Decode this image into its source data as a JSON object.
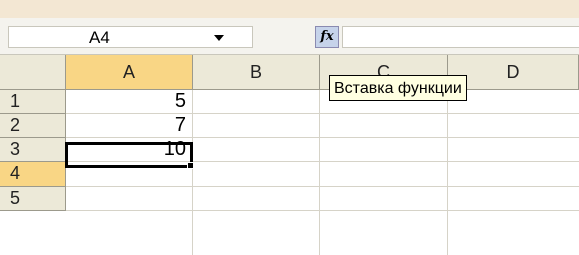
{
  "formula_bar": {
    "name_box_value": "A4",
    "fx_label": "fx",
    "formula_value": ""
  },
  "columns": [
    "A",
    "B",
    "C",
    "D"
  ],
  "rows": [
    "1",
    "2",
    "3",
    "4",
    "5"
  ],
  "cells": {
    "A1": "5",
    "A2": "7",
    "A3": "10",
    "A4": ""
  },
  "active_cell": "A4",
  "tooltip": {
    "text": "Вставка функции"
  },
  "colors": {
    "header_bg": "#ece9d8",
    "active_header_bg": "#f9d685",
    "tooltip_bg": "#ffffe1",
    "fx_button_bg": "#c6d3ea"
  }
}
